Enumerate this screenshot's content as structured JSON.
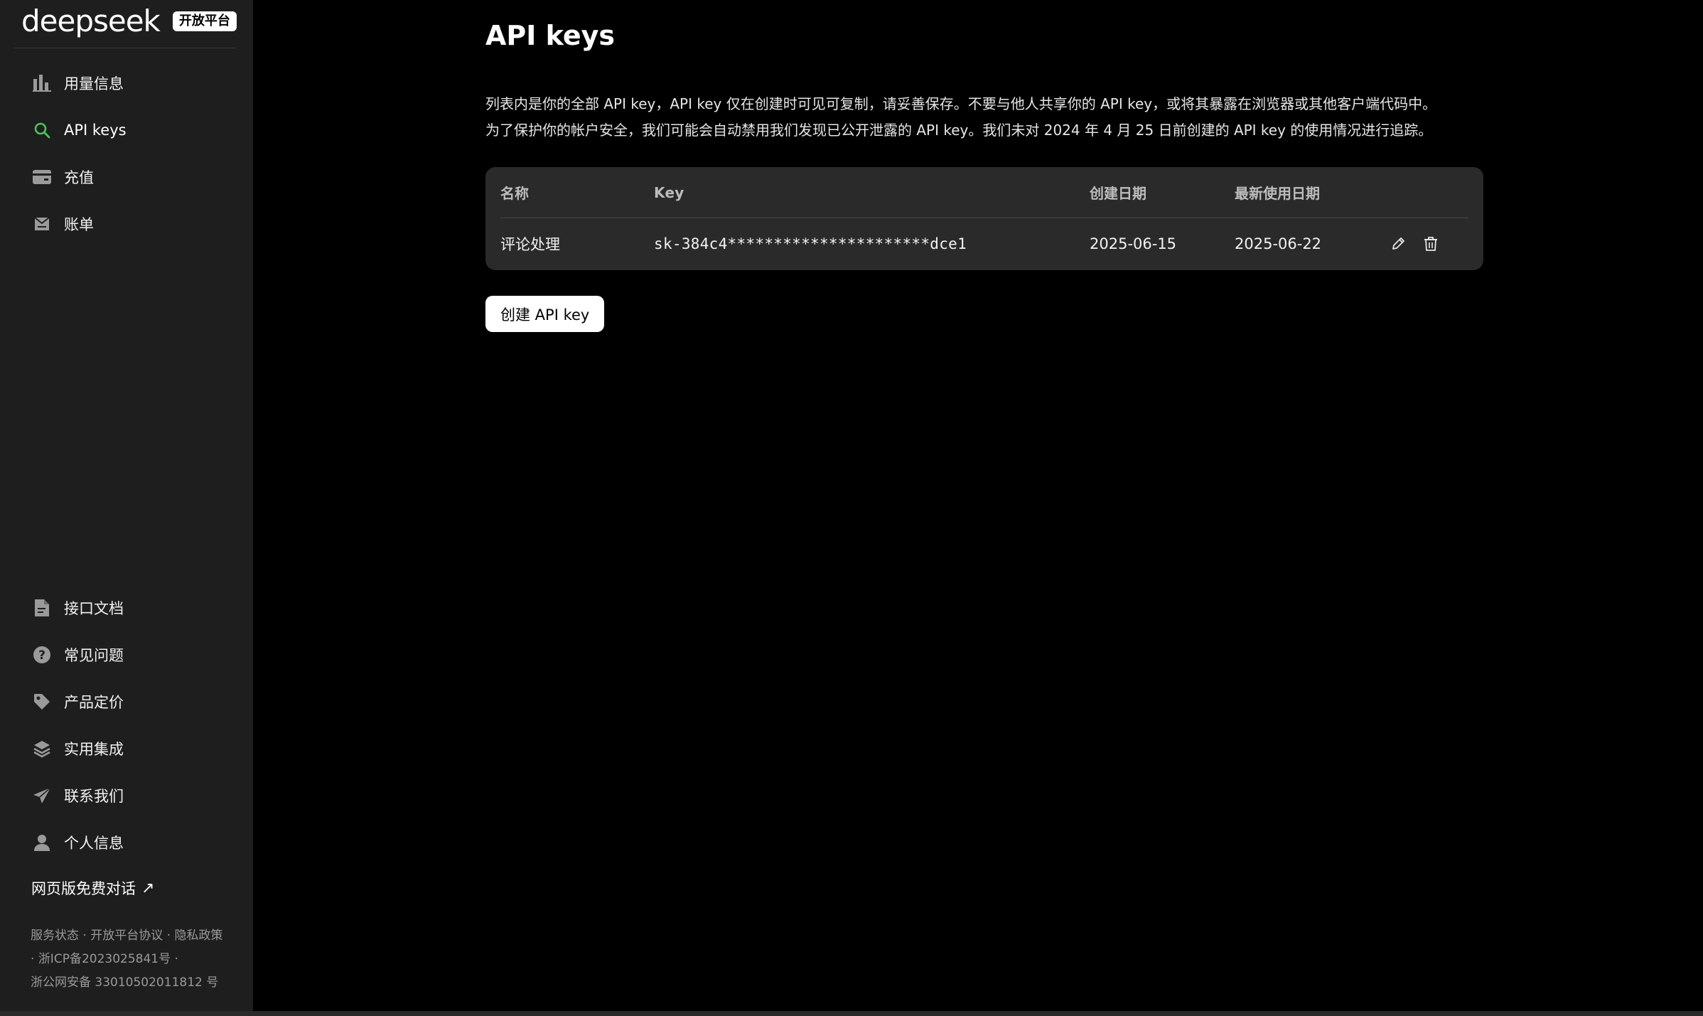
{
  "brand": {
    "logo": "deepseek",
    "badge": "开放平台"
  },
  "sidebar": {
    "top_items": [
      {
        "label": "用量信息",
        "icon": "bar-chart-icon"
      },
      {
        "label": "API keys",
        "icon": "search-icon",
        "active": true
      },
      {
        "label": "充值",
        "icon": "wallet-icon"
      },
      {
        "label": "账单",
        "icon": "bill-icon"
      }
    ],
    "bottom_items": [
      {
        "label": "接口文档",
        "icon": "document-icon"
      },
      {
        "label": "常见问题",
        "icon": "question-icon"
      },
      {
        "label": "产品定价",
        "icon": "tag-icon"
      },
      {
        "label": "实用集成",
        "icon": "layers-icon"
      },
      {
        "label": "联系我们",
        "icon": "send-icon"
      },
      {
        "label": "个人信息",
        "icon": "user-icon"
      }
    ],
    "web_chat": "网页版免费对话",
    "footer": {
      "service_status": "服务状态",
      "platform_agreement": "开放平台协议",
      "privacy": "隐私政策",
      "icp": "浙ICP备2023025841号",
      "police": "浙公网安备 33010502011812 号",
      "sep": " · "
    }
  },
  "main": {
    "title": "API keys",
    "desc_line1": "列表内是你的全部 API key，API key 仅在创建时可见可复制，请妥善保存。不要与他人共享你的 API key，或将其暴露在浏览器或其他客户端代码中。",
    "desc_line2": "为了保护你的帐户安全，我们可能会自动禁用我们发现已公开泄露的 API key。我们未对 2024 年 4 月 25 日前创建的 API key 的使用情况进行追踪。",
    "table": {
      "headers": [
        "名称",
        "Key",
        "创建日期",
        "最新使用日期"
      ],
      "rows": [
        {
          "name": "评论处理",
          "key": "sk-384c4**********************dce1",
          "created": "2025-06-15",
          "last_used": "2025-06-22"
        }
      ]
    },
    "create_button": "创建 API key"
  },
  "colors": {
    "sidebar_bg": "#1e1e1e",
    "main_bg": "#000000",
    "active_icon": "#4cc25a",
    "card_bg": "#2a2a2a"
  }
}
